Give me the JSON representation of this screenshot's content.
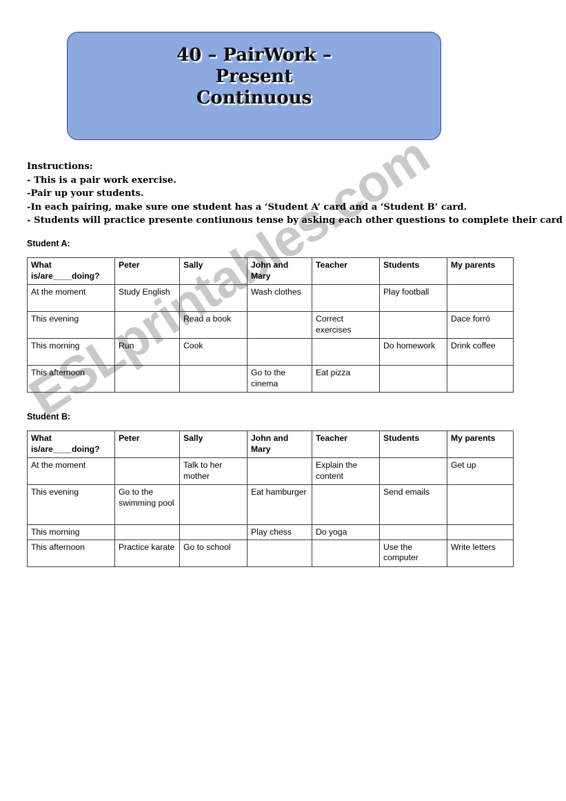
{
  "document": {
    "title_banner": {
      "text": "40 – PairWork –\nPresent\nContinuous",
      "fill_color": "#8ca9e0",
      "border_color": "#2f4d82"
    },
    "watermark": {
      "text": "ESLprintables.com",
      "color": "#c9c9c9"
    },
    "instructions": {
      "heading": "Instructions:",
      "lines": [
        "- This is a pair work exercise.",
        "-Pair up your students.",
        "-In each pairing, make sure one student has a ‘Student A’ card and a ‘Student B’ card.",
        "- Students will practice presente contiunous tense by asking each other questions to complete their card"
      ]
    },
    "sections": {
      "student_a_label": "Student A:",
      "student_b_label": "Student B:"
    }
  },
  "table_student_a": {
    "headers": [
      "What is/are____doing?",
      "Peter",
      "Sally",
      "John and Mary",
      "Teacher",
      "Students",
      "My parents"
    ],
    "rows": [
      {
        "label": "At the moment",
        "cells": [
          "Study English",
          "",
          "Wash clothes",
          "",
          "Play football",
          ""
        ]
      },
      {
        "label": "This evening",
        "cells": [
          "",
          "Read a book",
          "",
          "Correct exercises",
          "",
          "Dace forró"
        ]
      },
      {
        "label": "This morning",
        "cells": [
          "Run",
          "Cook",
          "",
          "",
          "Do homework",
          "Drink coffee"
        ]
      },
      {
        "label": "This afternoon",
        "cells": [
          "",
          "",
          "Go to the cinema",
          "Eat pizza",
          "",
          ""
        ]
      }
    ]
  },
  "table_student_b": {
    "headers": [
      "What is/are____doing?",
      "Peter",
      "Sally",
      "John and Mary",
      "Teacher",
      "Students",
      "My parents"
    ],
    "rows": [
      {
        "label": "At the moment",
        "cells": [
          "",
          "Talk to her mother",
          "",
          "Explain the content",
          "",
          "Get up"
        ]
      },
      {
        "label": "This evening",
        "cells": [
          "Go to the swimming pool",
          "",
          "Eat hamburger",
          "",
          "Send emails",
          ""
        ]
      },
      {
        "label": "This morning",
        "cells": [
          "",
          "",
          "Play chess",
          "Do yoga",
          "",
          ""
        ]
      },
      {
        "label": "This afternoon",
        "cells": [
          "Practice karate",
          "Go to school",
          "",
          "",
          "Use the computer",
          "Write letters"
        ]
      }
    ]
  }
}
